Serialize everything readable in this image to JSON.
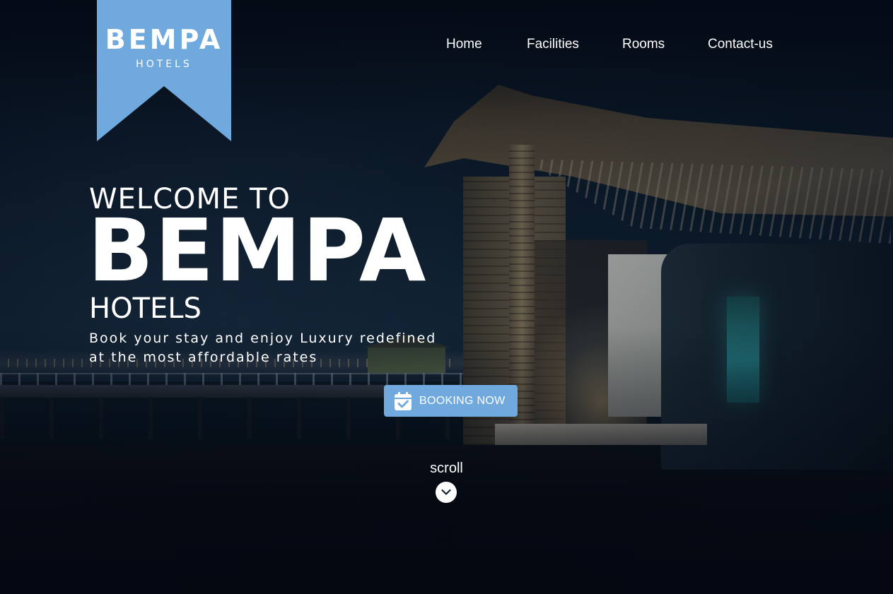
{
  "logo": {
    "title": "BEMPA",
    "subtitle": "HOTELS",
    "color": "#6fa9de"
  },
  "nav": {
    "items": [
      {
        "label": "Home"
      },
      {
        "label": "Facilities"
      },
      {
        "label": "Rooms"
      },
      {
        "label": "Contact-us"
      }
    ]
  },
  "hero": {
    "welcome": "WELCOME TO",
    "brand": "BEMPA",
    "hotels": "HOTELS",
    "tagline_line1": "Book your stay and enjoy Luxury redefined",
    "tagline_line2": "at the most affordable rates"
  },
  "booking": {
    "label": "BOOKING NOW",
    "icon": "calendar-check-icon",
    "color": "#6fa9de"
  },
  "scroll": {
    "label": "scroll",
    "icon": "chevron-down-icon"
  }
}
